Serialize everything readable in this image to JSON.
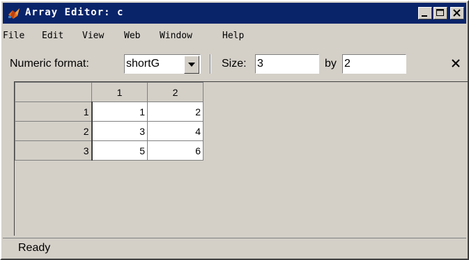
{
  "window": {
    "title": "Array Editor: c"
  },
  "menu": [
    {
      "label": "File"
    },
    {
      "label": "Edit"
    },
    {
      "label": "View"
    },
    {
      "label": "Web"
    },
    {
      "label": "Window"
    },
    {
      "label": "Help"
    }
  ],
  "toolbar": {
    "numeric_format_label": "Numeric format:",
    "numeric_format_value": "shortG",
    "size_label": "Size:",
    "rows_value": "3",
    "by_label": "by",
    "cols_value": "2"
  },
  "grid": {
    "column_headers": [
      "1",
      "2"
    ],
    "rows": [
      {
        "header": "1",
        "cells": [
          "1",
          "2"
        ]
      },
      {
        "header": "2",
        "cells": [
          "3",
          "4"
        ]
      },
      {
        "header": "3",
        "cells": [
          "5",
          "6"
        ]
      }
    ]
  },
  "status": {
    "text": "Ready"
  },
  "colors": {
    "titlebar": "#0a246a",
    "face": "#d4d0c8"
  },
  "icons": {
    "app": "matlab-logo-icon",
    "minimize": "minimize-icon",
    "maximize": "maximize-icon",
    "close": "close-icon",
    "dropdown": "chevron-down-icon",
    "toolbar_close": "close-icon"
  }
}
